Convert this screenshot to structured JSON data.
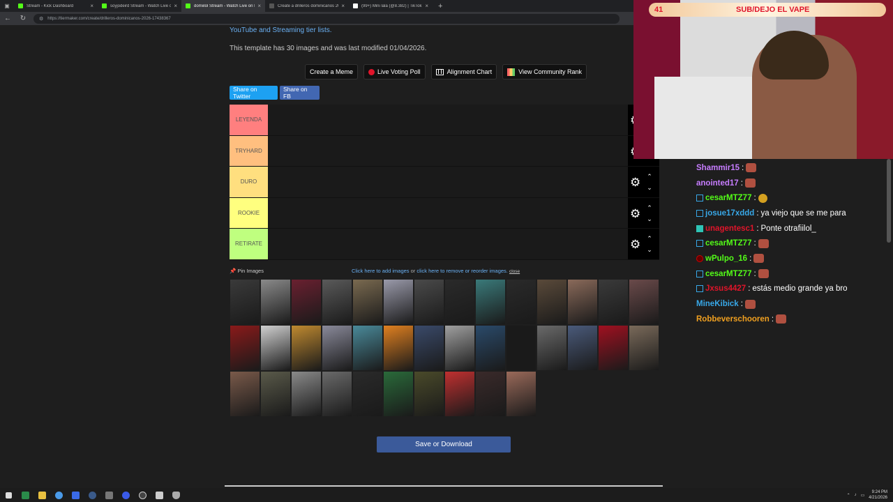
{
  "browser": {
    "tabs": [
      {
        "title": "Stream - Kick Dashboard",
        "color": "#53fc18",
        "active": false
      },
      {
        "title": "soyjodeird Stream - Watch Live o",
        "color": "#53fc18",
        "active": false
      },
      {
        "title": "domiilol Stream - Watch Live on K",
        "color": "#53fc18",
        "active": true
      },
      {
        "title": "Create a drilleros dominicanos 20",
        "color": "#555555",
        "active": false
      },
      {
        "title": "(99+) Mini lala (@8.382) | TikTok",
        "color": "#ffffff",
        "active": false
      }
    ],
    "url": "https://tiermaker.com/create/drilleros-dominicanos-2026-17438367"
  },
  "page": {
    "intro_link": "YouTube and Streaming tier lists.",
    "template_info": "This template has 30 images and was last modified 01/04/2026.",
    "actions": {
      "create_meme": "Create a Meme",
      "live_voting": "Live Voting Poll",
      "alignment": "Alignment Chart",
      "community_rank": "View Community Rank"
    },
    "share_twitter": "Share on Twitter",
    "share_fb": "Share on FB",
    "tiers": [
      {
        "label": "LEYENDA",
        "color": "#ff7f7f"
      },
      {
        "label": "TRYHARD",
        "color": "#ffbf7f"
      },
      {
        "label": "DURO",
        "color": "#ffdf7f"
      },
      {
        "label": "ROOKIE",
        "color": "#ffff7f"
      },
      {
        "label": "RETIRATE",
        "color": "#bfff7f"
      }
    ],
    "pin_images": "Pin Images",
    "add_images_link": "Click here to add images",
    "or_text": "or",
    "reorder_link": "click here to remove or reorder images.",
    "close_link": "close",
    "save_button": "Save or Download"
  },
  "overlay": {
    "count": "41",
    "text": "SUB/DEJO EL VAPE"
  },
  "chat": [
    {
      "user": "Shammir15",
      "color": "#c77dff",
      "badge": "",
      "text": "",
      "emote": "red"
    },
    {
      "user": "anointed17",
      "color": "#c77dff",
      "badge": "",
      "text": "",
      "emote": "red"
    },
    {
      "user": "cesarMTZ77",
      "color": "#53fc18",
      "badge": "blue",
      "text": "",
      "emote": "gold"
    },
    {
      "user": "josue17xddd",
      "color": "#38a8e8",
      "badge": "blue",
      "text": "ya viejo que se me para",
      "emote": ""
    },
    {
      "user": "unagentesc1",
      "color": "#e0142a",
      "badge": "green",
      "text": "Ponte otrafiilol_",
      "emote": ""
    },
    {
      "user": "cesarMTZ77",
      "color": "#53fc18",
      "badge": "blue",
      "text": "",
      "emote": "red"
    },
    {
      "user": "wPulpo_16",
      "color": "#53fc18",
      "badge": "red",
      "text": "",
      "emote": "red"
    },
    {
      "user": "cesarMTZ77",
      "color": "#53fc18",
      "badge": "blue",
      "text": "",
      "emote": "red"
    },
    {
      "user": "Jxsus4427",
      "color": "#e0142a",
      "badge": "blue",
      "text": "estás medio grande ya bro",
      "emote": ""
    },
    {
      "user": "MineKibick",
      "color": "#38a8e8",
      "badge": "",
      "text": "",
      "emote": "red"
    },
    {
      "user": "Robbeverschooren",
      "color": "#f0a020",
      "badge": "",
      "text": "",
      "emote": "red"
    }
  ],
  "taskbar": {
    "time": "9:24 PM",
    "date": "4/21/2026"
  },
  "thumb_colors": [
    "#3a3a3a",
    "#8a8a8a",
    "#6a2030",
    "#5a5a5a",
    "#7a6a50",
    "#9a9aaa",
    "#4a4a4a",
    "#2a2a2a",
    "#3a7a7a",
    "#2a2a2a",
    "#5a4a3a",
    "#8a6a5a",
    "#3a3a3a",
    "#6a4a4a",
    "#8a1a1a",
    "#d0d0d0",
    "#c08a30",
    "#8a8a9a",
    "#4a8a9a",
    "#e08020",
    "#3a4a6a",
    "#a0a0a0",
    "#2a4a6a",
    "#1a1a1a",
    "#6a6a6a",
    "#4a5a7a",
    "#a01020",
    "#7a6a5a",
    "#7a5a4a",
    "#5a5a4a",
    "#8a8a8a",
    "#6a6a6a",
    "#2a2a2a",
    "#2a6a3a",
    "#4a4a2a",
    "#c03030",
    "#3a2a2a",
    "#9a6a5a"
  ]
}
